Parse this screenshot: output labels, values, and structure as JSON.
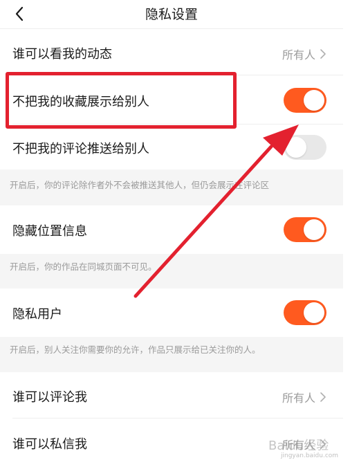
{
  "header": {
    "title": "隐私设置"
  },
  "rows": {
    "who_can_see_activity": {
      "label": "谁可以看我的动态",
      "value": "所有人"
    },
    "hide_favorites": {
      "label": "不把我的收藏展示给别人",
      "state": "on"
    },
    "hide_comments": {
      "label": "不把我的评论推送给别人",
      "state": "off"
    },
    "hide_location": {
      "label": "隐藏位置信息",
      "state": "on"
    },
    "private_user": {
      "label": "隐私用户",
      "state": "on"
    },
    "who_can_comment": {
      "label": "谁可以评论我",
      "value": "所有人"
    },
    "who_can_message": {
      "label": "谁可以私信我",
      "value": "所有人"
    }
  },
  "hints": {
    "comments": "开启后，你的评论除作者外不会被推送其他人，但仍会展示在评论区",
    "location": "开启后，你的作品在同城页面不可见。",
    "private_user": "开启后，别人关注你需要你的允许，作品只展示给已关注你的人。"
  },
  "icons": {
    "back": "chevron-left-icon",
    "value_chevron": "chevron-right-icon"
  },
  "colors": {
    "toggle_on": "#ff5a1f",
    "toggle_off": "#e8e8e8",
    "annotation": "#e3212f"
  }
}
